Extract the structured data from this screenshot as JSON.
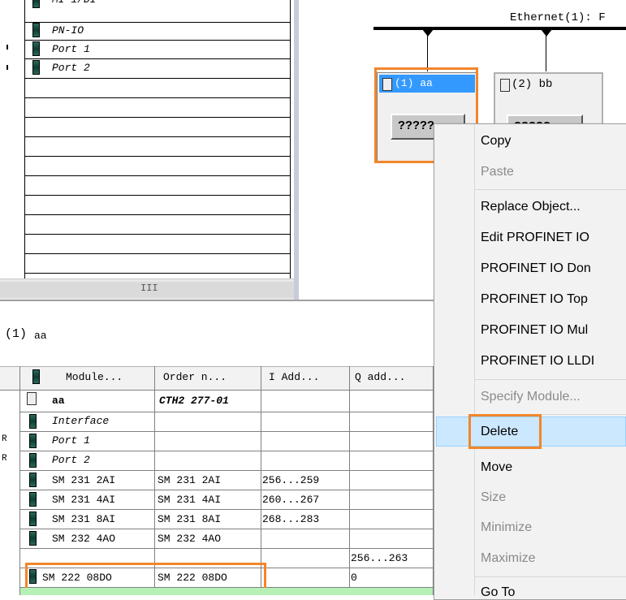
{
  "topleft": {
    "partial_first": "PN-IO",
    "rows": [
      "PN-IO",
      "Port 1",
      "Port 2"
    ],
    "hscroll_glyph": "III"
  },
  "network": {
    "label": "Ethernet(1): F"
  },
  "devices": [
    {
      "name": "(1) aa",
      "body": "?????"
    },
    {
      "name": "(2) bb",
      "body": "?????"
    }
  ],
  "detail": {
    "title_number": "(1)",
    "title_name": "aa",
    "columns": [
      "Module...",
      "Order n...",
      "I Add...",
      "Q add..."
    ],
    "rows": [
      {
        "module": "aa",
        "order": "CTH2 277-01",
        "i_addr": "",
        "q_addr": "",
        "bold": true
      },
      {
        "module": "Interface",
        "order": "",
        "i_addr": "",
        "q_addr": ""
      },
      {
        "module": "Port 1",
        "order": "",
        "i_addr": "",
        "q_addr": ""
      },
      {
        "module": "Port 2",
        "order": "",
        "i_addr": "",
        "q_addr": ""
      },
      {
        "module": "SM 231 2AI",
        "order": "SM 231 2AI",
        "i_addr": "256...259",
        "q_addr": ""
      },
      {
        "module": "SM 231 4AI",
        "order": "SM 231 4AI",
        "i_addr": "260...267",
        "q_addr": ""
      },
      {
        "module": "SM 231 8AI",
        "order": "SM 231 8AI",
        "i_addr": "268...283",
        "q_addr": ""
      },
      {
        "module": "SM 232 4AO",
        "order": "SM 232 4AO",
        "i_addr": "",
        "q_addr": "256...263"
      },
      {
        "module": "SM 222 08DO",
        "order": "SM 222 08DO",
        "i_addr": "",
        "q_addr": "0"
      }
    ]
  },
  "context_menu": {
    "items": [
      {
        "label": "Copy",
        "disabled": false
      },
      {
        "label": "Paste",
        "disabled": true
      },
      {
        "label": "Replace Object...",
        "disabled": false
      },
      {
        "label": "Edit PROFINET IO",
        "disabled": false
      },
      {
        "label": "PROFINET IO Don",
        "disabled": false
      },
      {
        "label": "PROFINET IO Top",
        "disabled": false
      },
      {
        "label": "PROFINET IO Mul",
        "disabled": false
      },
      {
        "label": "PROFINET IO LLDI",
        "disabled": false
      },
      {
        "label": "Specify Module...",
        "disabled": true
      },
      {
        "label": "Delete",
        "disabled": false,
        "highlighted": true
      },
      {
        "label": "Move",
        "disabled": false
      },
      {
        "label": "Size",
        "disabled": true
      },
      {
        "label": "Minimize",
        "disabled": true
      },
      {
        "label": "Maximize",
        "disabled": true
      },
      {
        "label": "Go To",
        "disabled": false
      }
    ]
  },
  "colors": {
    "highlight_orange": "#f2862a",
    "selection_blue": "#3399ff",
    "menu_bg": "#f2f2f2",
    "menu_hover": "#cce8ff"
  }
}
